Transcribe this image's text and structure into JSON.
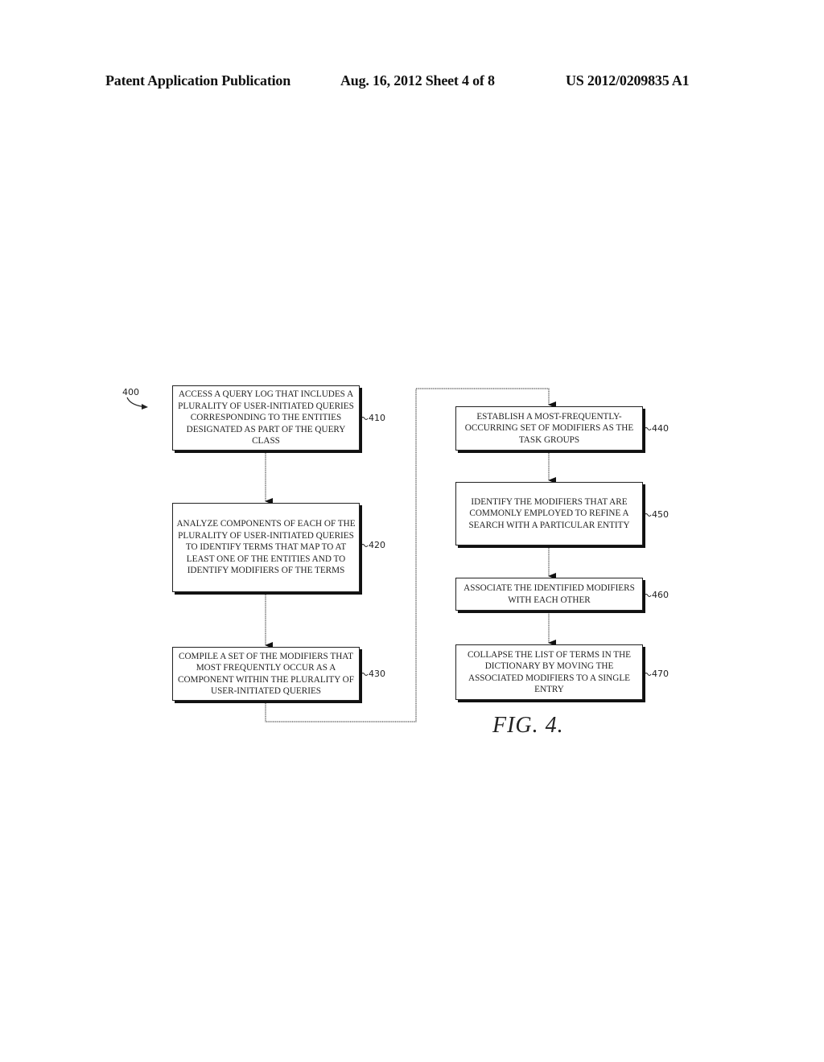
{
  "header": {
    "publication": "Patent Application Publication",
    "date_sheet": "Aug. 16, 2012   Sheet 4 of 8",
    "number": "US 2012/0209835 A1"
  },
  "figure": {
    "ref": "400",
    "caption": "FIG. 4.",
    "steps": [
      {
        "id": "410",
        "text": "ACCESS A QUERY LOG THAT INCLUDES A PLURALITY OF USER-INITIATED QUERIES CORRESPONDING TO THE ENTITIES DESIGNATED AS PART OF THE QUERY CLASS"
      },
      {
        "id": "420",
        "text": "ANALYZE COMPONENTS OF EACH OF THE PLURALITY OF USER-INITIATED QUERIES TO IDENTIFY TERMS THAT MAP TO AT LEAST ONE OF THE ENTITIES AND TO IDENTIFY MODIFIERS OF THE TERMS"
      },
      {
        "id": "430",
        "text": "COMPILE A SET OF THE MODIFIERS THAT MOST FREQUENTLY OCCUR AS A COMPONENT WITHIN THE PLURALITY OF USER-INITIATED QUERIES"
      },
      {
        "id": "440",
        "text": "ESTABLISH A MOST-FREQUENTLY-OCCURRING SET OF MODIFIERS AS THE TASK GROUPS"
      },
      {
        "id": "450",
        "text": "IDENTIFY THE MODIFIERS THAT ARE COMMONLY EMPLOYED TO REFINE A SEARCH WITH A PARTICULAR ENTITY"
      },
      {
        "id": "460",
        "text": "ASSOCIATE THE IDENTIFIED MODIFIERS WITH EACH OTHER"
      },
      {
        "id": "470",
        "text": "COLLAPSE THE LIST OF TERMS IN THE DICTIONARY BY MOVING THE ASSOCIATED MODIFIERS TO A SINGLE ENTRY"
      }
    ]
  }
}
